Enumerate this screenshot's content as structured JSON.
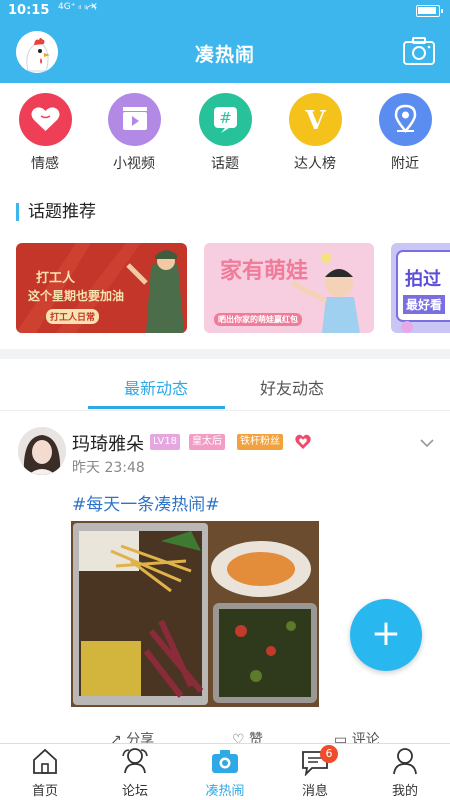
{
  "status_bar": {
    "time": "10:15",
    "signal": "4G⁺ ᵢₗ ᵢₗ ✕",
    "wifi": "◠",
    "battery_level": 0.95
  },
  "header": {
    "title": "凑热闹",
    "logo_icon": "chicken-mascot-icon",
    "camera_icon": "camera-icon"
  },
  "quick_links": [
    {
      "label": "情感",
      "icon": "heart-icon",
      "color": "#ee3f57"
    },
    {
      "label": "小视频",
      "icon": "video-clapper-icon",
      "color": "#b28ae6"
    },
    {
      "label": "话题",
      "icon": "hashtag-icon",
      "color": "#27c19a"
    },
    {
      "label": "达人榜",
      "icon": "v-badge-icon",
      "color": "#f5c21b"
    },
    {
      "label": "附近",
      "icon": "location-pin-icon",
      "color": "#5b8cf0"
    }
  ],
  "section": {
    "title": "话题推荐"
  },
  "banners": [
    {
      "text_line1": "打工人",
      "text_line2": "这个星期也要加油",
      "tag": "打工人日常",
      "bg": "#c4352a"
    },
    {
      "text_line1": "家有萌娃",
      "tag": "晒出你家的萌娃赢红包",
      "bg": "#f7cde0"
    },
    {
      "text_line1": "拍过",
      "text_line2": "最好看",
      "bg": "#c9c6f5"
    }
  ],
  "tabs": [
    {
      "label": "最新动态",
      "active": true
    },
    {
      "label": "好友动态",
      "active": false
    }
  ],
  "post": {
    "user": "玛琦雅朵",
    "badges": [
      {
        "text": "LV18",
        "color": "#e6a6e0"
      },
      {
        "text": "皇太后",
        "color": "#f39dc6"
      },
      {
        "text": "铁杆粉丝",
        "color": "#f2a23c"
      }
    ],
    "time": "昨天 23:48",
    "hashtag": "#每天一条凑热闹#"
  },
  "actions": [
    {
      "label": "分享",
      "icon": "share-icon"
    },
    {
      "label": "赞",
      "icon": "like-icon"
    },
    {
      "label": "评论",
      "icon": "comment-icon"
    }
  ],
  "fab": {
    "label": "+"
  },
  "bottom_nav": [
    {
      "label": "首页",
      "icon": "home-icon",
      "active": false
    },
    {
      "label": "论坛",
      "icon": "forum-icon",
      "active": false
    },
    {
      "label": "凑热闹",
      "icon": "camera-icon",
      "active": true
    },
    {
      "label": "消息",
      "icon": "message-icon",
      "active": false,
      "badge": "6"
    },
    {
      "label": "我的",
      "icon": "profile-icon",
      "active": false
    }
  ]
}
